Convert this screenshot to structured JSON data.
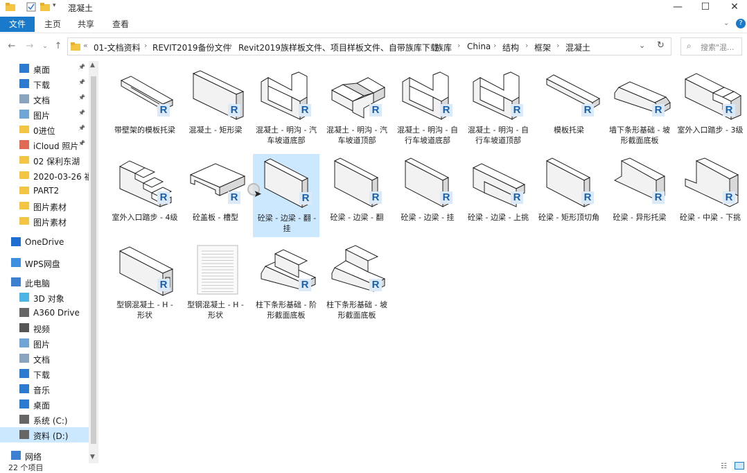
{
  "window": {
    "title": "混凝土",
    "minimize": "—",
    "maximize": "☐",
    "close": "✕"
  },
  "ribbon": {
    "tabs": [
      "文件",
      "主页",
      "共享",
      "查看"
    ]
  },
  "address": {
    "prefix": "«",
    "crumbs": [
      "01-文档资料",
      "REVIT2019备份文件",
      "Revit2019族样板文件、项目样板文件、自带族库下载",
      "族库",
      "China",
      "结构",
      "框架",
      "混凝土"
    ],
    "search_placeholder": "搜索\"混..."
  },
  "sidebar": {
    "items": [
      {
        "label": "桌面",
        "icon": "desktop-icon",
        "pinned": true
      },
      {
        "label": "下载",
        "icon": "download-icon",
        "pinned": true
      },
      {
        "label": "文档",
        "icon": "document-icon",
        "pinned": true
      },
      {
        "label": "图片",
        "icon": "picture-icon",
        "pinned": true
      },
      {
        "label": "0进位",
        "icon": "folder-icon",
        "pinned": true
      },
      {
        "label": "iCloud 照片",
        "icon": "icloud-icon",
        "pinned": true
      },
      {
        "label": "02 保利东湖",
        "icon": "folder-icon",
        "pinned": false
      },
      {
        "label": "2020-03-26 福",
        "icon": "folder-icon",
        "pinned": false
      },
      {
        "label": "PART2",
        "icon": "folder-icon",
        "pinned": false
      },
      {
        "label": "图片素材",
        "icon": "folder-icon",
        "pinned": false
      },
      {
        "label": "图片素材",
        "icon": "folder-icon",
        "pinned": false
      },
      {
        "label": "OneDrive",
        "icon": "onedrive-icon",
        "pinned": false
      },
      {
        "label": "WPS网盘",
        "icon": "cloud-icon",
        "pinned": false
      },
      {
        "label": "此电脑",
        "icon": "pc-icon",
        "pinned": false
      },
      {
        "label": "3D 对象",
        "icon": "3d-icon",
        "pinned": false
      },
      {
        "label": "A360 Drive",
        "icon": "drive-icon",
        "pinned": false
      },
      {
        "label": "视频",
        "icon": "video-icon",
        "pinned": false
      },
      {
        "label": "图片",
        "icon": "picture-icon",
        "pinned": false
      },
      {
        "label": "文档",
        "icon": "document-icon",
        "pinned": false
      },
      {
        "label": "下载",
        "icon": "download-icon",
        "pinned": false
      },
      {
        "label": "音乐",
        "icon": "music-icon",
        "pinned": false
      },
      {
        "label": "桌面",
        "icon": "desktop-icon",
        "pinned": false
      },
      {
        "label": "系统 (C:)",
        "icon": "disk-icon",
        "pinned": false
      },
      {
        "label": "资料 (D:)",
        "icon": "disk-icon",
        "pinned": false
      },
      {
        "label": "网络",
        "icon": "network-icon",
        "pinned": false
      }
    ]
  },
  "files": [
    {
      "name": "带壁架的模板托梁",
      "shape": "slab-ledge"
    },
    {
      "name": "混凝土 - 矩形梁",
      "shape": "rect-beam"
    },
    {
      "name": "混凝土 - 明沟 - 汽车坡道底部",
      "shape": "u-channel"
    },
    {
      "name": "混凝土 - 明沟 - 汽车坡道顶部",
      "shape": "u-channel-top"
    },
    {
      "name": "混凝土 - 明沟 - 自行车坡道底部",
      "shape": "u-channel"
    },
    {
      "name": "混凝土 - 明沟 - 自行车坡道顶部",
      "shape": "u-channel"
    },
    {
      "name": "模板托梁",
      "shape": "thin-beam"
    },
    {
      "name": "墙下条形基础 - 坡形截面底板",
      "shape": "slope-footing"
    },
    {
      "name": "室外入口踏步 - 3级",
      "shape": "steps3"
    },
    {
      "name": "室外入口踏步 - 4级",
      "shape": "steps4"
    },
    {
      "name": "砼盖板 - 槽型",
      "shape": "channel-slab"
    },
    {
      "name": "砼梁 - 边梁 - 翻 - 挂",
      "shape": "edge-beam",
      "selected": true
    },
    {
      "name": "砼梁 - 边梁 - 翻",
      "shape": "edge-beam"
    },
    {
      "name": "砼梁 - 边梁 - 挂",
      "shape": "edge-beam"
    },
    {
      "name": "砼梁 - 边梁 - 上挑",
      "shape": "edge-up"
    },
    {
      "name": "砼梁 - 矩形顶切角",
      "shape": "edge-beam"
    },
    {
      "name": "砼梁 - 异形托梁",
      "shape": "special"
    },
    {
      "name": "砼梁 - 中梁 - 下挑",
      "shape": "mid-down"
    },
    {
      "name": "型钢混凝土 - H - 形状",
      "shape": "h-beam"
    },
    {
      "name": "型钢混凝土 - H - 形状",
      "shape": "doc"
    },
    {
      "name": "柱下条形基础 - 阶形截面底板",
      "shape": "step-footing"
    },
    {
      "name": "柱下条形基础 - 坡形截面底板",
      "shape": "slope-footing2"
    }
  ],
  "badge": "R",
  "status": {
    "count": "22 个项目"
  }
}
